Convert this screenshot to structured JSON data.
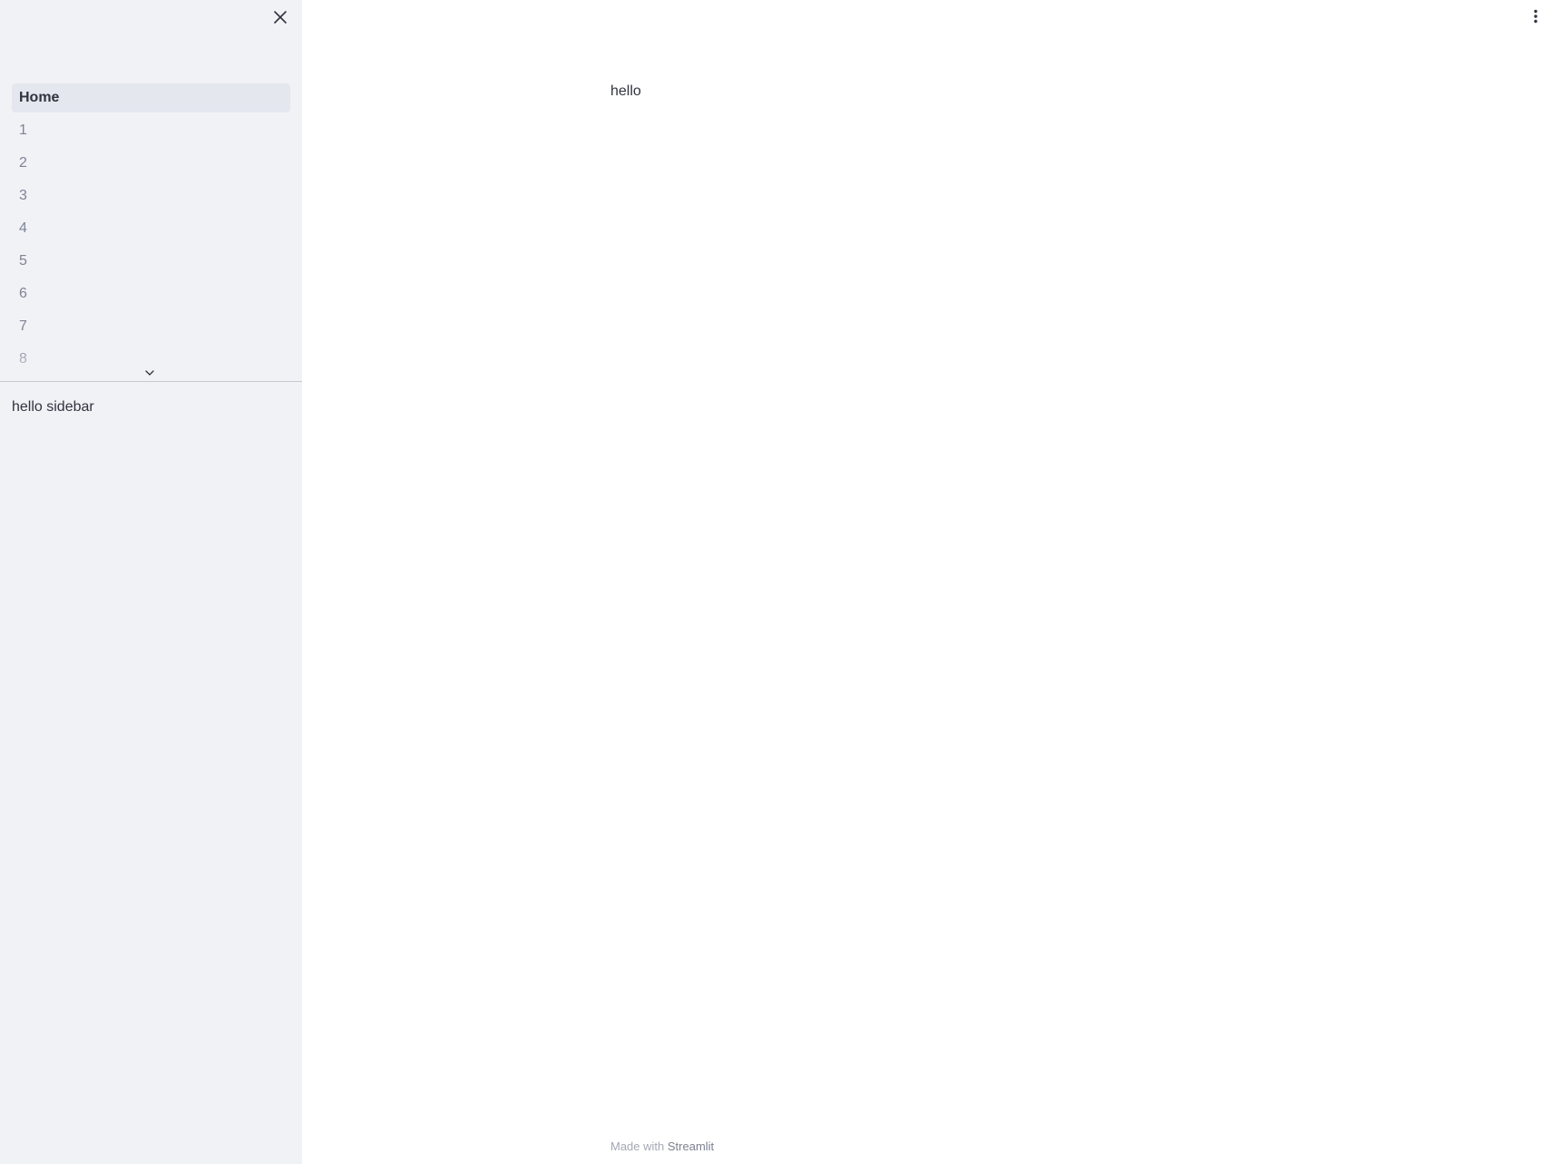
{
  "sidebar": {
    "nav_items": [
      {
        "label": "Home",
        "active": true
      },
      {
        "label": "1",
        "active": false
      },
      {
        "label": "2",
        "active": false
      },
      {
        "label": "3",
        "active": false
      },
      {
        "label": "4",
        "active": false
      },
      {
        "label": "5",
        "active": false
      },
      {
        "label": "6",
        "active": false
      },
      {
        "label": "7",
        "active": false
      },
      {
        "label": "8",
        "active": false
      }
    ],
    "text": "hello sidebar",
    "close_icon": "close-icon",
    "expand_icon": "chevron-down-icon"
  },
  "main": {
    "text": "hello",
    "menu_icon": "vertical-ellipsis-icon"
  },
  "footer": {
    "prefix": "Made with",
    "link": "Streamlit"
  },
  "colors": {
    "sidebar_bg": "#f0f2f6",
    "active_item_bg": "#e4e7ee",
    "text": "#31333f",
    "muted_text": "#808495"
  }
}
